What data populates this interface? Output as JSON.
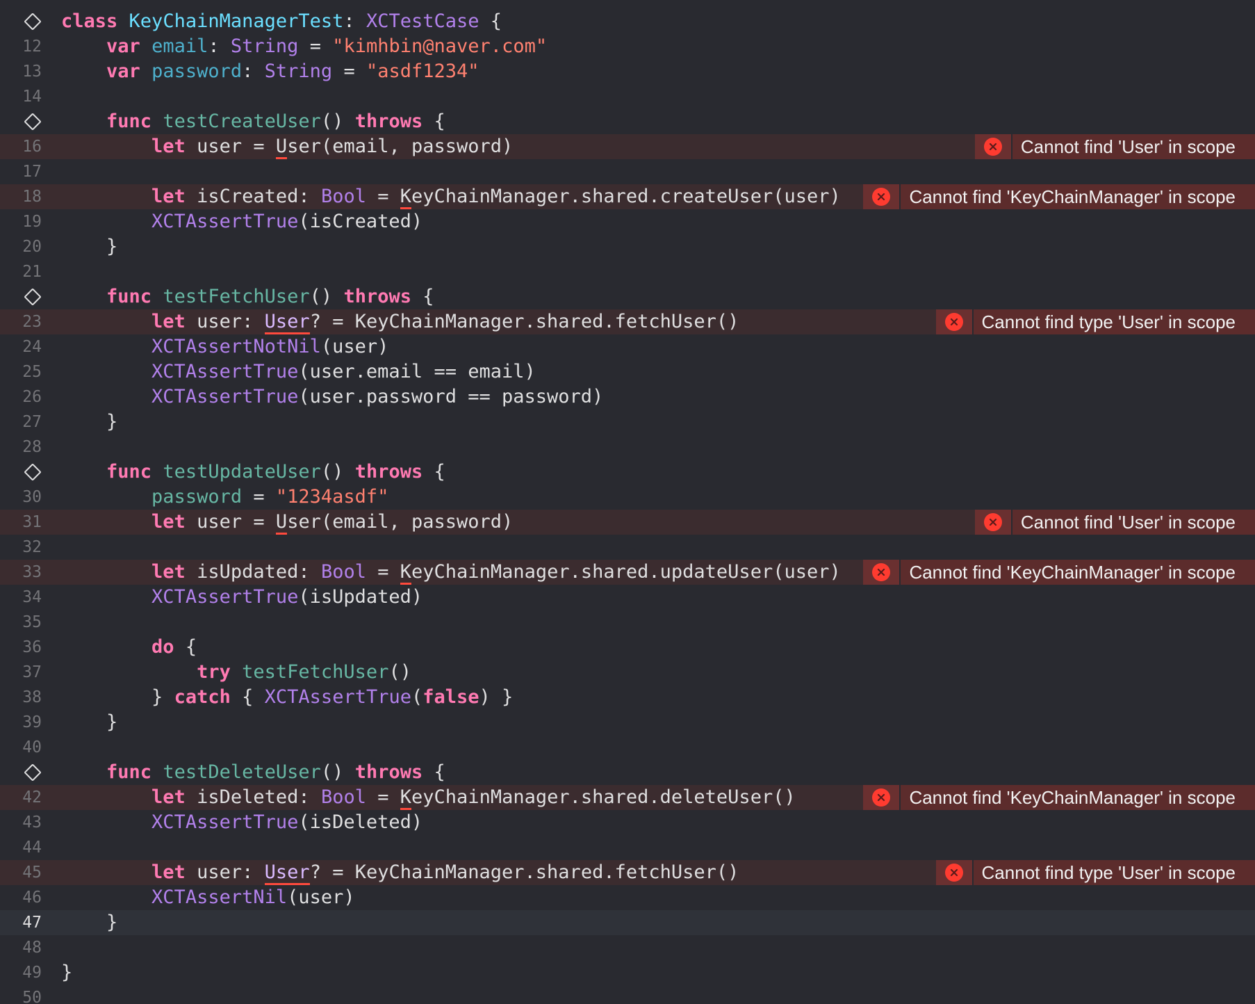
{
  "editor": {
    "first_line_fragment": "10",
    "last_line_fragment": "50",
    "current_line": "47",
    "colors": {
      "background": "#292a30",
      "error_line": "#3b2c2f",
      "current_line": "#2f3239",
      "annotation_bg": "#5c2c2c",
      "error_icon": "#ff3b30",
      "keyword": "#ff7ab2",
      "string": "#ff8170",
      "type": "#dabaff",
      "library_call": "#b281eb",
      "project_symbol": "#67b7a4"
    },
    "lines": [
      {
        "num": "",
        "marker": "test-diamond",
        "tokens": [
          "class",
          "KeyChainManagerTest",
          ":",
          "XCTestCase",
          "{"
        ]
      },
      {
        "num": "12",
        "tokens": [
          "var",
          "email",
          ":",
          "String",
          "=",
          "\"kimhbin@naver.com\""
        ]
      },
      {
        "num": "13",
        "tokens": [
          "var",
          "password",
          ":",
          "String",
          "=",
          "\"asdf1234\""
        ]
      },
      {
        "num": "14",
        "tokens": []
      },
      {
        "num": "",
        "marker": "test-diamond",
        "tokens": [
          "func",
          "testCreateUser",
          "()",
          "throws",
          "{"
        ]
      },
      {
        "num": "16",
        "tokens": [
          "let",
          "user",
          "=",
          "U",
          "ser",
          "(email, password)"
        ],
        "error": "Cannot find 'User' in scope"
      },
      {
        "num": "17",
        "tokens": []
      },
      {
        "num": "18",
        "tokens": [
          "let",
          "isCreated",
          ":",
          "Bool",
          "=",
          "K",
          "eyChainManager.shared.createUser(user)"
        ],
        "error": "Cannot find 'KeyChainManager' in scope"
      },
      {
        "num": "19",
        "tokens": [
          "XCTAssertTrue",
          "(isCreated)"
        ]
      },
      {
        "num": "20",
        "tokens": [
          "}"
        ]
      },
      {
        "num": "21",
        "tokens": []
      },
      {
        "num": "",
        "marker": "test-diamond",
        "tokens": [
          "func",
          "testFetchUser",
          "()",
          "throws",
          "{"
        ]
      },
      {
        "num": "23",
        "tokens": [
          "let",
          "user",
          ":",
          "User",
          "? = KeyChainManager.shared.fetchUser()"
        ],
        "error": "Cannot find type 'User' in scope"
      },
      {
        "num": "24",
        "tokens": [
          "XCTAssertNotNil",
          "(user)"
        ]
      },
      {
        "num": "25",
        "tokens": [
          "XCTAssertTrue",
          "(user.email == email)"
        ]
      },
      {
        "num": "26",
        "tokens": [
          "XCTAssertTrue",
          "(user.password == password)"
        ]
      },
      {
        "num": "27",
        "tokens": [
          "}"
        ]
      },
      {
        "num": "28",
        "tokens": []
      },
      {
        "num": "",
        "marker": "test-diamond",
        "tokens": [
          "func",
          "testUpdateUser",
          "()",
          "throws",
          "{"
        ]
      },
      {
        "num": "30",
        "tokens": [
          "password",
          "=",
          "\"1234asdf\""
        ]
      },
      {
        "num": "31",
        "tokens": [
          "let",
          "user",
          "=",
          "U",
          "ser",
          "(email, password)"
        ],
        "error": "Cannot find 'User' in scope"
      },
      {
        "num": "32",
        "tokens": []
      },
      {
        "num": "33",
        "tokens": [
          "let",
          "isUpdated",
          ":",
          "Bool",
          "=",
          "K",
          "eyChainManager.shared.updateUser(user)"
        ],
        "error": "Cannot find 'KeyChainManager' in scope"
      },
      {
        "num": "34",
        "tokens": [
          "XCTAssertTrue",
          "(isUpdated)"
        ]
      },
      {
        "num": "35",
        "tokens": []
      },
      {
        "num": "36",
        "tokens": [
          "do",
          "{"
        ]
      },
      {
        "num": "37",
        "tokens": [
          "try",
          "testFetchUser",
          "()"
        ]
      },
      {
        "num": "38",
        "tokens": [
          "}",
          "catch",
          "{",
          "XCTAssertTrue",
          "(",
          "false",
          ") }"
        ]
      },
      {
        "num": "39",
        "tokens": [
          "}"
        ]
      },
      {
        "num": "40",
        "tokens": []
      },
      {
        "num": "",
        "marker": "test-diamond",
        "tokens": [
          "func",
          "testDeleteUser",
          "()",
          "throws",
          "{"
        ]
      },
      {
        "num": "42",
        "tokens": [
          "let",
          "isDeleted",
          ":",
          "Bool",
          "=",
          "K",
          "eyChainManager.shared.deleteUser()"
        ],
        "error": "Cannot find 'KeyChainManager' in scope"
      },
      {
        "num": "43",
        "tokens": [
          "XCTAssertTrue",
          "(isDeleted)"
        ]
      },
      {
        "num": "44",
        "tokens": []
      },
      {
        "num": "45",
        "tokens": [
          "let",
          "user",
          ":",
          "User",
          "? = KeyChainManager.shared.fetchUser()"
        ],
        "error": "Cannot find type 'User' in scope"
      },
      {
        "num": "46",
        "tokens": [
          "XCTAssertNil",
          "(user)"
        ]
      },
      {
        "num": "47",
        "tokens": [
          "}"
        ]
      },
      {
        "num": "48",
        "tokens": []
      },
      {
        "num": "49",
        "tokens": [
          "}"
        ]
      }
    ],
    "error_icon": "error-circle-x-icon"
  }
}
